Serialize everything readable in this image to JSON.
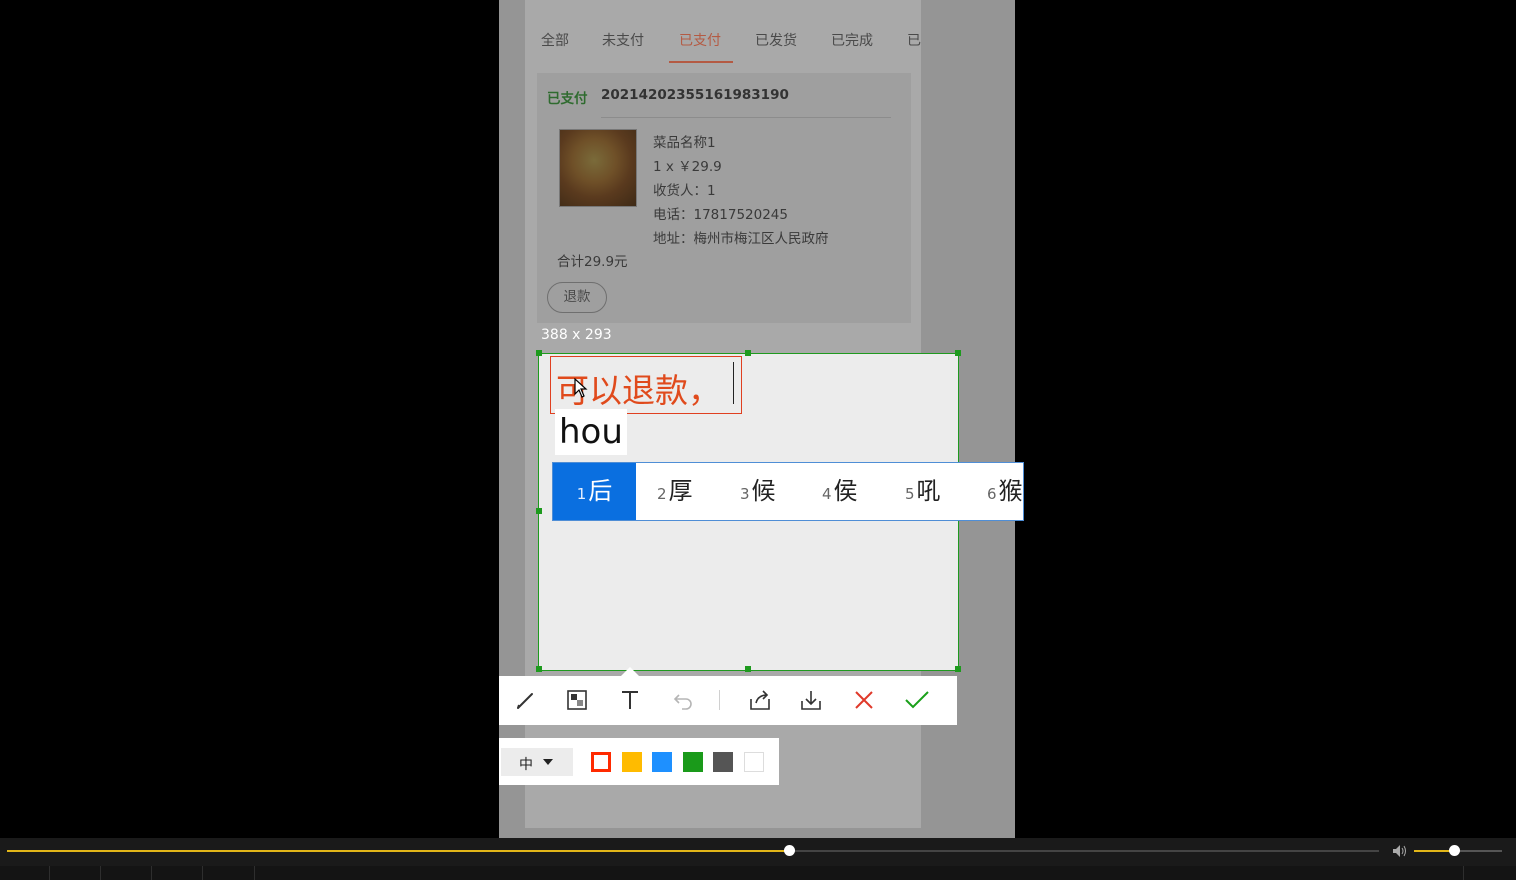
{
  "tabs": [
    {
      "label": "全部"
    },
    {
      "label": "未支付"
    },
    {
      "label": "已支付"
    },
    {
      "label": "已发货"
    },
    {
      "label": "已完成"
    },
    {
      "label": "已"
    }
  ],
  "active_tab": "已支付",
  "order": {
    "status": "已支付",
    "order_no": "20214202355161983190",
    "dish_name": "菜品名称1",
    "qty_price": "1 x ￥29.9",
    "receiver": "收货人：1",
    "phone": "电话：17817520245",
    "address": "地址：梅州市梅江区人民政府",
    "total": "合计29.9元",
    "refund_button": "退款"
  },
  "capture": {
    "dimensions_label": "388 x 293",
    "text_content": "可以退款，",
    "ime_composition": "hou",
    "candidates": [
      {
        "num": "1",
        "char": "后"
      },
      {
        "num": "2",
        "char": "厚"
      },
      {
        "num": "3",
        "char": "候"
      },
      {
        "num": "4",
        "char": "侯"
      },
      {
        "num": "5",
        "char": "吼"
      },
      {
        "num": "6",
        "char": "猴"
      }
    ]
  },
  "toolbar": {
    "tools": [
      "pencil-icon",
      "mosaic-icon",
      "text-icon",
      "undo-icon",
      "share-icon",
      "download-icon",
      "close-icon",
      "confirm-icon"
    ]
  },
  "text_options": {
    "size_label": "中",
    "colors": [
      "#ff2a00",
      "#ffbb00",
      "#1e90ff",
      "#1a9a1a",
      "#555555",
      "#ffffff"
    ]
  },
  "player": {
    "progress_fraction": 0.57,
    "volume_fraction": 0.45
  }
}
